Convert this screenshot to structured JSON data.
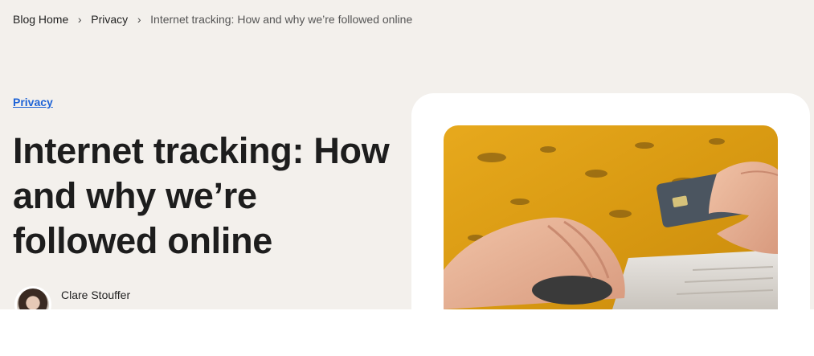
{
  "breadcrumb": {
    "items": [
      {
        "label": "Blog Home"
      },
      {
        "label": "Privacy"
      },
      {
        "label": "Internet tracking: How and why we’re followed online"
      }
    ],
    "separator_icon": "chevron-right-icon"
  },
  "article": {
    "category": "Privacy",
    "title": "Internet tracking: How and why we’re followed online",
    "author": {
      "name": "Clare Stouffer",
      "avatar_icon": "avatar"
    },
    "hero_image_icon": "person-holding-credit-card-using-laptop-image"
  },
  "colors": {
    "page_background": "#f3f0ec",
    "link": "#1e63d6",
    "text": "#1d1d1d",
    "card": "#ffffff"
  }
}
